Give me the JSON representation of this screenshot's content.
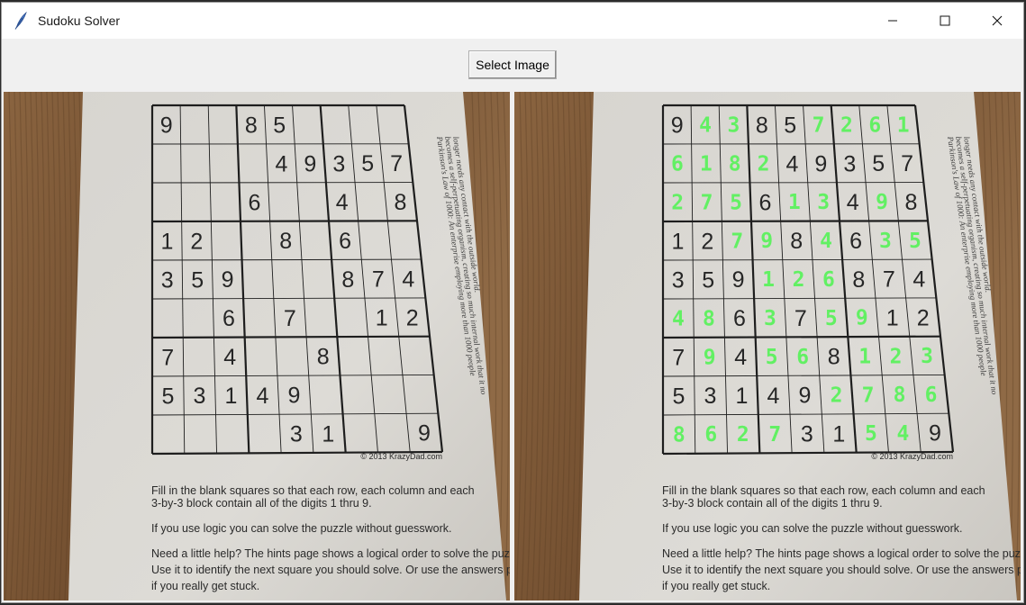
{
  "window": {
    "title": "Sudoku Solver"
  },
  "toolbar": {
    "select_label": "Select Image"
  },
  "icons": {
    "app": "feather-icon",
    "minimize": "minimize-icon",
    "maximize": "maximize-icon",
    "close": "close-icon"
  },
  "colors": {
    "solved_digit": "#62f063",
    "printed_digit": "#262626",
    "paper": "#dcdcd8",
    "wood": "#7a5636"
  },
  "puzzle": {
    "given": [
      [
        9,
        0,
        0,
        8,
        5,
        0,
        0,
        0,
        0
      ],
      [
        0,
        0,
        0,
        0,
        4,
        9,
        3,
        5,
        7
      ],
      [
        0,
        0,
        0,
        6,
        0,
        0,
        4,
        0,
        8
      ],
      [
        1,
        2,
        0,
        0,
        8,
        0,
        6,
        0,
        0
      ],
      [
        3,
        5,
        9,
        0,
        0,
        0,
        8,
        7,
        4
      ],
      [
        0,
        0,
        6,
        0,
        7,
        0,
        0,
        1,
        2
      ],
      [
        7,
        0,
        4,
        0,
        0,
        8,
        0,
        0,
        0
      ],
      [
        5,
        3,
        1,
        4,
        9,
        0,
        0,
        0,
        0
      ],
      [
        0,
        0,
        0,
        0,
        3,
        1,
        0,
        0,
        9
      ]
    ],
    "solution": [
      [
        9,
        4,
        3,
        8,
        5,
        7,
        2,
        6,
        1
      ],
      [
        6,
        1,
        8,
        2,
        4,
        9,
        3,
        5,
        7
      ],
      [
        2,
        7,
        5,
        6,
        1,
        3,
        4,
        9,
        8
      ],
      [
        1,
        2,
        7,
        9,
        8,
        4,
        6,
        3,
        5
      ],
      [
        3,
        5,
        9,
        1,
        2,
        6,
        8,
        7,
        4
      ],
      [
        4,
        8,
        6,
        3,
        7,
        5,
        9,
        1,
        2
      ],
      [
        7,
        9,
        4,
        5,
        6,
        8,
        1,
        2,
        3
      ],
      [
        5,
        3,
        1,
        4,
        9,
        2,
        7,
        8,
        6
      ],
      [
        8,
        6,
        2,
        7,
        3,
        1,
        5,
        4,
        9
      ]
    ]
  },
  "sheet": {
    "copyright": "© 2013 KrazyDad.com",
    "instructions": [
      "Fill in the blank squares so that each row, each column and each",
      "3-by-3 block contain all of the digits 1 thru 9.",
      "If you use logic you can solve the puzzle without guesswork.",
      "Need a little help?  The hints page shows a logical order to solve the puzzle.",
      "Use it to identify the next square you should solve.  Or use the answers page",
      "if you really get stuck."
    ],
    "side_note": [
      "Parkinson's Law of 1000: An enterprise employing more than 1000 people",
      "becomes a self-perpetuating organism, creating so much internal work that it no",
      "longer needs any contact with the outside world."
    ]
  }
}
